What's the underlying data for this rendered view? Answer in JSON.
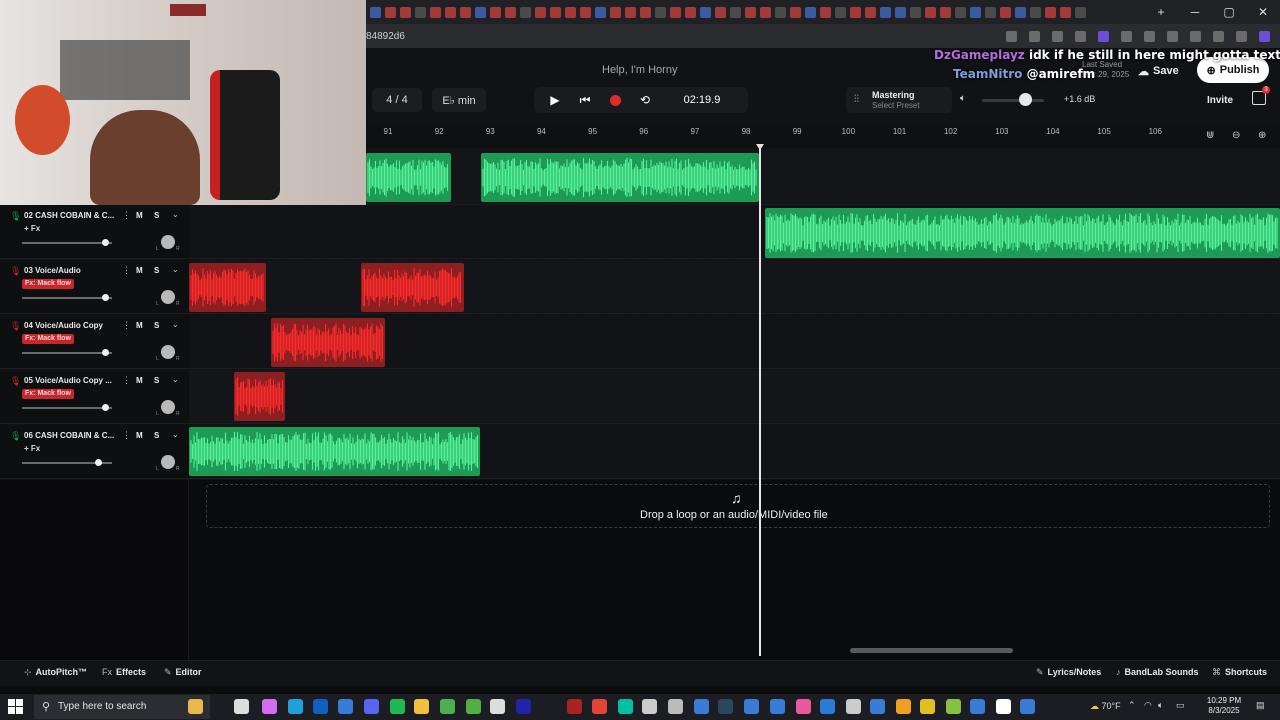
{
  "browser": {
    "url": "84892d6",
    "window_controls": {
      "minimize": "─",
      "maximize": "▢",
      "close": "✕"
    },
    "new_tab": "+"
  },
  "overlay_chat": {
    "line1": {
      "user": "DzGameplayz",
      "message": "idk if he still in here might gotta text him"
    },
    "line2": {
      "user": "TeamNitro",
      "message": "@amirefm"
    }
  },
  "header": {
    "project_title": "Help, I'm Horny",
    "last_saved_label": "Last Saved",
    "last_saved_date": "Mar 29, 2025",
    "save_label": "Save",
    "publish_label": "Publish",
    "invite_label": "Invite",
    "notification_count": "3"
  },
  "transport": {
    "time_signature": "4 / 4",
    "key": "E♭ min",
    "time": "02:19.9",
    "mastering_label": "Mastering",
    "mastering_preset": "Select Preset",
    "master_volume_db": "+1.6 dB",
    "master_volume_level": 0.7
  },
  "ruler": {
    "bars": [
      "91",
      "92",
      "93",
      "94",
      "95",
      "96",
      "97",
      "98",
      "99",
      "100",
      "101",
      "102",
      "103",
      "104",
      "105",
      "106"
    ]
  },
  "tracks": [
    {
      "name": "02  CASH COBAIN & C...",
      "fx": "+ Fx",
      "fx_style": "plain",
      "mute": "M",
      "solo": "S",
      "color": "#1e9a55",
      "volume": 0.93
    },
    {
      "name": "03  Voice/Audio",
      "fx": "Fx: Mack flow",
      "fx_style": "red",
      "mute": "M",
      "solo": "S",
      "color": "#c7262b",
      "volume": 0.93
    },
    {
      "name": "04  Voice/Audio Copy",
      "fx": "Fx: Mack flow",
      "fx_style": "red",
      "mute": "M",
      "solo": "S",
      "color": "#c7262b",
      "volume": 0.93
    },
    {
      "name": "05  Voice/Audio Copy ...",
      "fx": "Fx: Mack flow",
      "fx_style": "red",
      "mute": "M",
      "solo": "S",
      "color": "#c7262b",
      "volume": 0.93
    },
    {
      "name": "06  CASH COBAIN & C...",
      "fx": "+ Fx",
      "fx_style": "plain",
      "mute": "M",
      "solo": "S",
      "color": "#1e9a55",
      "volume": 0.85
    }
  ],
  "pan_labels": {
    "left": "L",
    "right": "R"
  },
  "dropzone": {
    "text": "Drop a loop or an audio/MIDI/video file"
  },
  "bottombar": {
    "autopitch": "AutoPitch™",
    "effects": "Effects",
    "editor": "Editor",
    "lyrics": "Lyrics/Notes",
    "sounds": "BandLab Sounds",
    "shortcuts": "Shortcuts"
  },
  "taskbar": {
    "search_placeholder": "Type here to search",
    "temperature": "70°F",
    "time": "10:29 PM",
    "date": "8/3/2025"
  }
}
